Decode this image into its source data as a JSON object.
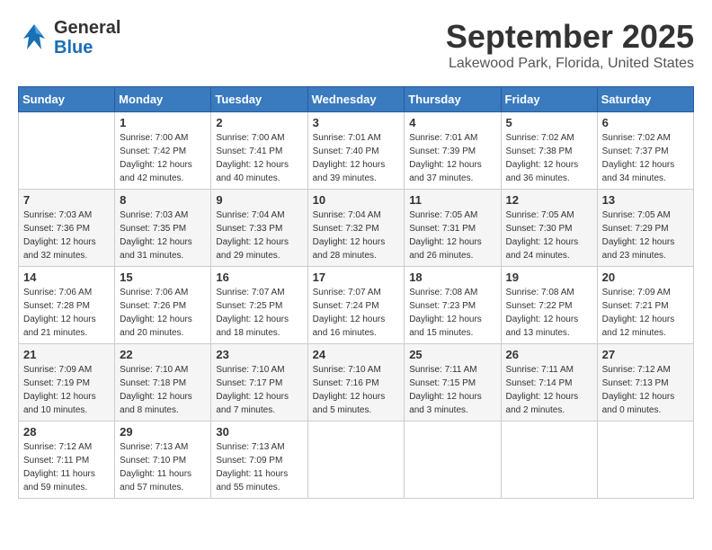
{
  "header": {
    "logo_general": "General",
    "logo_blue": "Blue",
    "month_title": "September 2025",
    "location": "Lakewood Park, Florida, United States"
  },
  "weekdays": [
    "Sunday",
    "Monday",
    "Tuesday",
    "Wednesday",
    "Thursday",
    "Friday",
    "Saturday"
  ],
  "weeks": [
    [
      {
        "day": "",
        "sunrise": "",
        "sunset": "",
        "daylight": ""
      },
      {
        "day": "1",
        "sunrise": "Sunrise: 7:00 AM",
        "sunset": "Sunset: 7:42 PM",
        "daylight": "Daylight: 12 hours and 42 minutes."
      },
      {
        "day": "2",
        "sunrise": "Sunrise: 7:00 AM",
        "sunset": "Sunset: 7:41 PM",
        "daylight": "Daylight: 12 hours and 40 minutes."
      },
      {
        "day": "3",
        "sunrise": "Sunrise: 7:01 AM",
        "sunset": "Sunset: 7:40 PM",
        "daylight": "Daylight: 12 hours and 39 minutes."
      },
      {
        "day": "4",
        "sunrise": "Sunrise: 7:01 AM",
        "sunset": "Sunset: 7:39 PM",
        "daylight": "Daylight: 12 hours and 37 minutes."
      },
      {
        "day": "5",
        "sunrise": "Sunrise: 7:02 AM",
        "sunset": "Sunset: 7:38 PM",
        "daylight": "Daylight: 12 hours and 36 minutes."
      },
      {
        "day": "6",
        "sunrise": "Sunrise: 7:02 AM",
        "sunset": "Sunset: 7:37 PM",
        "daylight": "Daylight: 12 hours and 34 minutes."
      }
    ],
    [
      {
        "day": "7",
        "sunrise": "Sunrise: 7:03 AM",
        "sunset": "Sunset: 7:36 PM",
        "daylight": "Daylight: 12 hours and 32 minutes."
      },
      {
        "day": "8",
        "sunrise": "Sunrise: 7:03 AM",
        "sunset": "Sunset: 7:35 PM",
        "daylight": "Daylight: 12 hours and 31 minutes."
      },
      {
        "day": "9",
        "sunrise": "Sunrise: 7:04 AM",
        "sunset": "Sunset: 7:33 PM",
        "daylight": "Daylight: 12 hours and 29 minutes."
      },
      {
        "day": "10",
        "sunrise": "Sunrise: 7:04 AM",
        "sunset": "Sunset: 7:32 PM",
        "daylight": "Daylight: 12 hours and 28 minutes."
      },
      {
        "day": "11",
        "sunrise": "Sunrise: 7:05 AM",
        "sunset": "Sunset: 7:31 PM",
        "daylight": "Daylight: 12 hours and 26 minutes."
      },
      {
        "day": "12",
        "sunrise": "Sunrise: 7:05 AM",
        "sunset": "Sunset: 7:30 PM",
        "daylight": "Daylight: 12 hours and 24 minutes."
      },
      {
        "day": "13",
        "sunrise": "Sunrise: 7:05 AM",
        "sunset": "Sunset: 7:29 PM",
        "daylight": "Daylight: 12 hours and 23 minutes."
      }
    ],
    [
      {
        "day": "14",
        "sunrise": "Sunrise: 7:06 AM",
        "sunset": "Sunset: 7:28 PM",
        "daylight": "Daylight: 12 hours and 21 minutes."
      },
      {
        "day": "15",
        "sunrise": "Sunrise: 7:06 AM",
        "sunset": "Sunset: 7:26 PM",
        "daylight": "Daylight: 12 hours and 20 minutes."
      },
      {
        "day": "16",
        "sunrise": "Sunrise: 7:07 AM",
        "sunset": "Sunset: 7:25 PM",
        "daylight": "Daylight: 12 hours and 18 minutes."
      },
      {
        "day": "17",
        "sunrise": "Sunrise: 7:07 AM",
        "sunset": "Sunset: 7:24 PM",
        "daylight": "Daylight: 12 hours and 16 minutes."
      },
      {
        "day": "18",
        "sunrise": "Sunrise: 7:08 AM",
        "sunset": "Sunset: 7:23 PM",
        "daylight": "Daylight: 12 hours and 15 minutes."
      },
      {
        "day": "19",
        "sunrise": "Sunrise: 7:08 AM",
        "sunset": "Sunset: 7:22 PM",
        "daylight": "Daylight: 12 hours and 13 minutes."
      },
      {
        "day": "20",
        "sunrise": "Sunrise: 7:09 AM",
        "sunset": "Sunset: 7:21 PM",
        "daylight": "Daylight: 12 hours and 12 minutes."
      }
    ],
    [
      {
        "day": "21",
        "sunrise": "Sunrise: 7:09 AM",
        "sunset": "Sunset: 7:19 PM",
        "daylight": "Daylight: 12 hours and 10 minutes."
      },
      {
        "day": "22",
        "sunrise": "Sunrise: 7:10 AM",
        "sunset": "Sunset: 7:18 PM",
        "daylight": "Daylight: 12 hours and 8 minutes."
      },
      {
        "day": "23",
        "sunrise": "Sunrise: 7:10 AM",
        "sunset": "Sunset: 7:17 PM",
        "daylight": "Daylight: 12 hours and 7 minutes."
      },
      {
        "day": "24",
        "sunrise": "Sunrise: 7:10 AM",
        "sunset": "Sunset: 7:16 PM",
        "daylight": "Daylight: 12 hours and 5 minutes."
      },
      {
        "day": "25",
        "sunrise": "Sunrise: 7:11 AM",
        "sunset": "Sunset: 7:15 PM",
        "daylight": "Daylight: 12 hours and 3 minutes."
      },
      {
        "day": "26",
        "sunrise": "Sunrise: 7:11 AM",
        "sunset": "Sunset: 7:14 PM",
        "daylight": "Daylight: 12 hours and 2 minutes."
      },
      {
        "day": "27",
        "sunrise": "Sunrise: 7:12 AM",
        "sunset": "Sunset: 7:13 PM",
        "daylight": "Daylight: 12 hours and 0 minutes."
      }
    ],
    [
      {
        "day": "28",
        "sunrise": "Sunrise: 7:12 AM",
        "sunset": "Sunset: 7:11 PM",
        "daylight": "Daylight: 11 hours and 59 minutes."
      },
      {
        "day": "29",
        "sunrise": "Sunrise: 7:13 AM",
        "sunset": "Sunset: 7:10 PM",
        "daylight": "Daylight: 11 hours and 57 minutes."
      },
      {
        "day": "30",
        "sunrise": "Sunrise: 7:13 AM",
        "sunset": "Sunset: 7:09 PM",
        "daylight": "Daylight: 11 hours and 55 minutes."
      },
      {
        "day": "",
        "sunrise": "",
        "sunset": "",
        "daylight": ""
      },
      {
        "day": "",
        "sunrise": "",
        "sunset": "",
        "daylight": ""
      },
      {
        "day": "",
        "sunrise": "",
        "sunset": "",
        "daylight": ""
      },
      {
        "day": "",
        "sunrise": "",
        "sunset": "",
        "daylight": ""
      }
    ]
  ]
}
